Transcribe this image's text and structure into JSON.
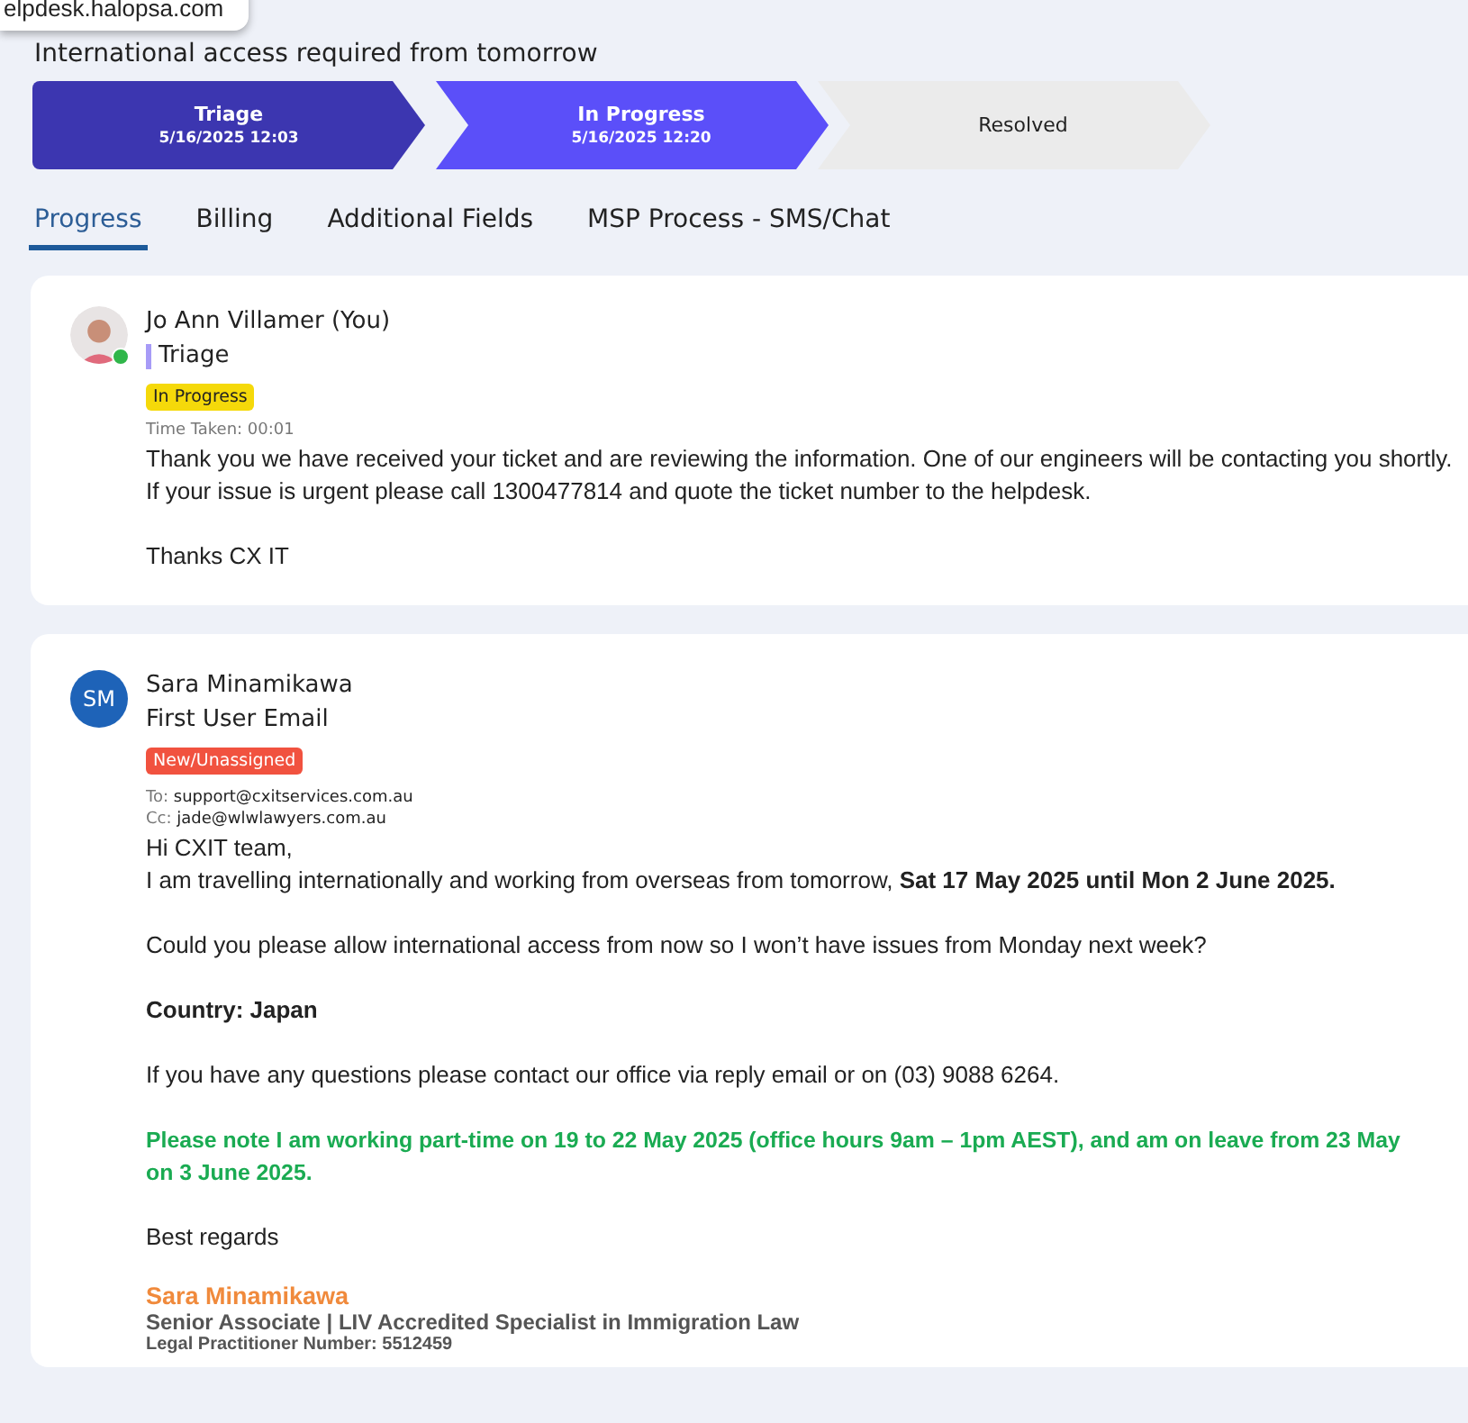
{
  "url_tooltip": "elpdesk.halopsa.com",
  "ticket_title": "International access required from tomorrow",
  "stages": [
    {
      "name": "Triage",
      "time": "5/16/2025 12:03",
      "completed": true,
      "selected": false
    },
    {
      "name": "In Progress",
      "time": "5/16/2025 12:20",
      "selected": true
    },
    {
      "name": "Resolved",
      "completed": false,
      "selected": false
    }
  ],
  "tabs": [
    {
      "label": "Progress",
      "selected": true
    },
    {
      "label": "Billing",
      "selected": false
    },
    {
      "label": "Additional Fields",
      "selected": false
    },
    {
      "label": "MSP Process - SMS/Chat",
      "selected": false
    }
  ],
  "messages": [
    {
      "avatar": {
        "kind": "photo",
        "online": true
      },
      "author": "Jo Ann Villamer (You)",
      "action": "Triage",
      "action_marker": true,
      "status": {
        "label": "In Progress",
        "color": "#f5d90a"
      },
      "time_taken": {
        "label": "Time Taken:",
        "value": "00:01"
      },
      "body": [
        {
          "kind": "text",
          "lines": [
            "Thank you we have received your ticket and are reviewing the information. One of our engineers will be contacting you shortly.",
            "If your issue is urgent please call 1300477814 and quote the ticket number to the helpdesk."
          ]
        },
        {
          "kind": "text",
          "lines": [
            "Thanks CX IT"
          ]
        }
      ]
    },
    {
      "avatar": {
        "kind": "initials",
        "text": "SM",
        "online": false
      },
      "author": "Sara Minamikawa",
      "action": "First User Email",
      "action_marker": false,
      "status": {
        "label": "New/Unassigned",
        "color": "#f1523f"
      },
      "to": {
        "label": "To:",
        "value": "support@cxitservices.com.au"
      },
      "cc": {
        "label": "Cc:",
        "value": "jade@wlwlawyers.com.au"
      },
      "body": [
        {
          "kind": "text",
          "lines": [
            "Hi CXIT team,",
            "I am travelling internationally and working from overseas from tomorrow, **Sat 17 May 2025 until Mon 2 June 2025.**"
          ]
        },
        {
          "kind": "text",
          "lines": [
            "Could you please allow international access from now so I won’t have issues from Monday next week?"
          ]
        },
        {
          "kind": "bold",
          "lines": [
            "Country: Japan"
          ]
        },
        {
          "kind": "text",
          "lines": [
            "If you have any questions please contact our office via reply email or on (03) 9088 6264."
          ]
        },
        {
          "kind": "notice",
          "lines": [
            "Please note I am working part-time on 19 to 22 May 2025 (office hours 9am – 1pm AEST), and am on leave from 23 May",
            "on 3 June 2025."
          ]
        },
        {
          "kind": "text",
          "lines": [
            "Best regards"
          ]
        }
      ],
      "signature": {
        "name": "Sara Minamikawa",
        "title": "Senior Associate | LIV Accredited Specialist in Immigration Law",
        "number": "Legal Practitioner Number: 5512459"
      }
    }
  ]
}
